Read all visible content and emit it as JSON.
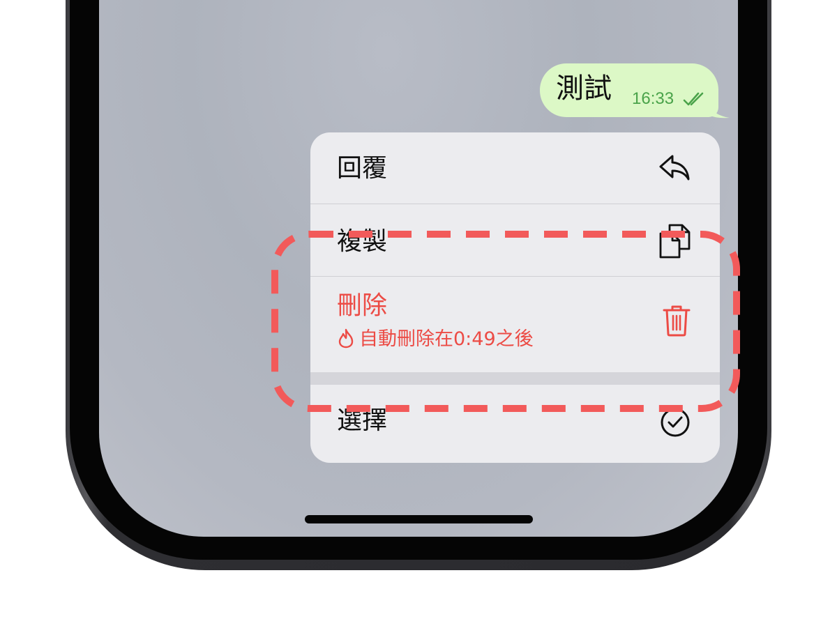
{
  "message": {
    "text": "測試",
    "time": "16:33",
    "read_icon": "double-check-icon",
    "bubble_color": "#dcf8c6",
    "time_color": "#4aa34a"
  },
  "context_menu": {
    "items": [
      {
        "label": "回覆",
        "icon": "reply-arrow-icon"
      },
      {
        "label": "複製",
        "icon": "copy-documents-icon"
      },
      {
        "label": "刪除",
        "sublabel": "自動刪除在0:49之後",
        "sub_icon": "flame-icon",
        "icon": "trash-icon",
        "destructive": true
      },
      {
        "label": "選擇",
        "icon": "check-circle-icon"
      }
    ],
    "destructive_color": "#ec4b45"
  },
  "annotation": {
    "style": "dashed-rounded-rect",
    "color": "#f25a5a"
  }
}
